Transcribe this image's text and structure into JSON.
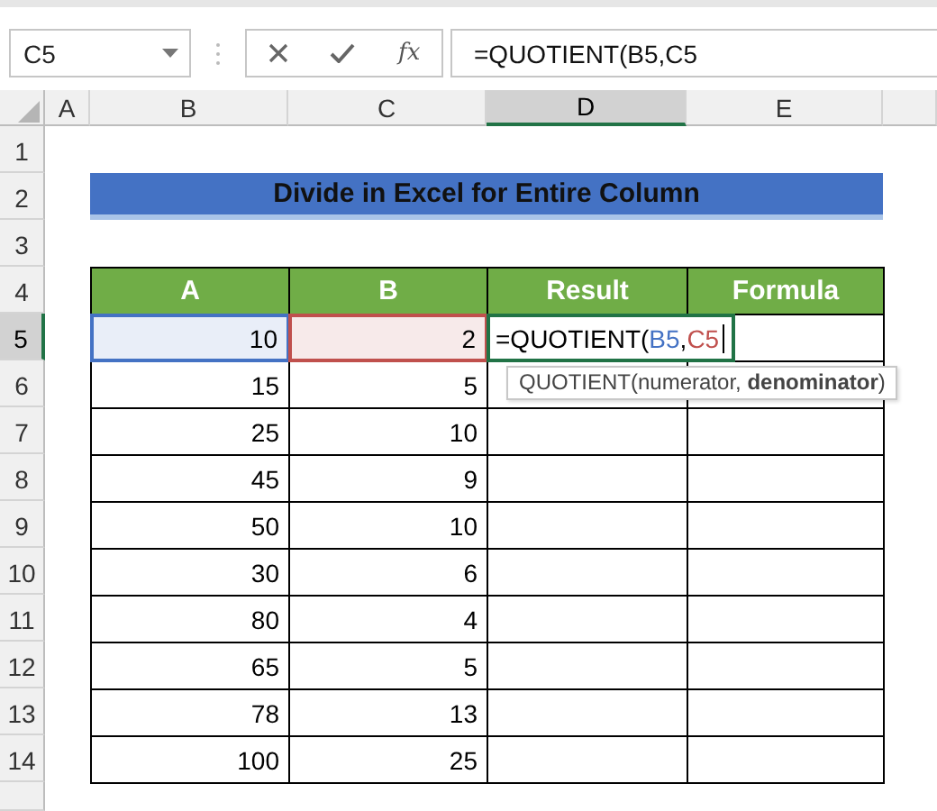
{
  "name_box": "C5",
  "formula_bar": {
    "function_label": "fx",
    "formula": "=QUOTIENT(B5,C5"
  },
  "columns": [
    {
      "label": "A",
      "selected": false
    },
    {
      "label": "B",
      "selected": false
    },
    {
      "label": "C",
      "selected": false
    },
    {
      "label": "D",
      "selected": true
    },
    {
      "label": "E",
      "selected": false
    }
  ],
  "row_headers": [
    {
      "label": "1",
      "selected": false
    },
    {
      "label": "2",
      "selected": false
    },
    {
      "label": "3",
      "selected": false
    },
    {
      "label": "4",
      "selected": false
    },
    {
      "label": "5",
      "selected": true
    },
    {
      "label": "6",
      "selected": false
    },
    {
      "label": "7",
      "selected": false
    },
    {
      "label": "8",
      "selected": false
    },
    {
      "label": "9",
      "selected": false
    },
    {
      "label": "10",
      "selected": false
    },
    {
      "label": "11",
      "selected": false
    },
    {
      "label": "12",
      "selected": false
    },
    {
      "label": "13",
      "selected": false
    },
    {
      "label": "14",
      "selected": false
    }
  ],
  "banner": "Divide in Excel for Entire Column",
  "table": {
    "columns": [
      "A",
      "B",
      "Result",
      "Formula"
    ],
    "rows": [
      {
        "cells": [
          {
            "value": "10",
            "color": "#4472c4"
          },
          {
            "value": "2",
            "color": "#c0504d"
          }
        ],
        "editing": [
          {
            "text": "=QUOTIENT(",
            "color": "#000000"
          },
          {
            "text": "B5",
            "color": "#4472c4"
          },
          {
            "text": ",",
            "color": "#000000"
          },
          {
            "text": "C5",
            "color": "#c0504d"
          }
        ],
        "hint": "QUOTIENT(numerator, **denominator**)"
      },
      {
        "cells": [
          {
            "value": "15"
          },
          {
            "value": "5"
          }
        ]
      },
      {
        "cells": [
          {
            "value": "25"
          },
          {
            "value": "10"
          }
        ]
      },
      {
        "cells": [
          {
            "value": "45"
          },
          {
            "value": "9"
          }
        ]
      },
      {
        "cells": [
          {
            "value": "50"
          },
          {
            "value": "10"
          }
        ]
      },
      {
        "cells": [
          {
            "value": "30"
          },
          {
            "value": "6"
          }
        ]
      },
      {
        "cells": [
          {
            "value": "80"
          },
          {
            "value": "4"
          }
        ]
      },
      {
        "cells": [
          {
            "value": "65"
          },
          {
            "value": "5"
          }
        ]
      },
      {
        "cells": [
          {
            "value": "78"
          },
          {
            "value": "13"
          }
        ]
      },
      {
        "cells": [
          {
            "value": "100"
          },
          {
            "value": "25"
          }
        ]
      }
    ]
  }
}
